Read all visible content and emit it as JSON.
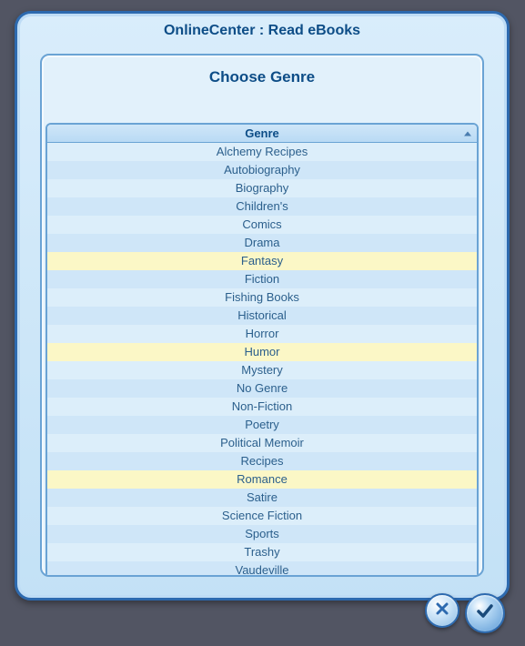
{
  "dialog": {
    "title": "OnlineCenter : Read eBooks",
    "subtitle": "Choose Genre",
    "column_header": "Genre"
  },
  "genres": [
    {
      "label": "Alchemy Recipes",
      "highlight": false
    },
    {
      "label": "Autobiography",
      "highlight": false
    },
    {
      "label": "Biography",
      "highlight": false
    },
    {
      "label": "Children's",
      "highlight": false
    },
    {
      "label": "Comics",
      "highlight": false
    },
    {
      "label": "Drama",
      "highlight": false
    },
    {
      "label": "Fantasy",
      "highlight": true
    },
    {
      "label": "Fiction",
      "highlight": false
    },
    {
      "label": "Fishing Books",
      "highlight": false
    },
    {
      "label": "Historical",
      "highlight": false
    },
    {
      "label": "Horror",
      "highlight": false
    },
    {
      "label": "Humor",
      "highlight": true
    },
    {
      "label": "Mystery",
      "highlight": false
    },
    {
      "label": "No Genre",
      "highlight": false
    },
    {
      "label": "Non-Fiction",
      "highlight": false
    },
    {
      "label": "Poetry",
      "highlight": false
    },
    {
      "label": "Political Memoir",
      "highlight": false
    },
    {
      "label": "Recipes",
      "highlight": false
    },
    {
      "label": "Romance",
      "highlight": true
    },
    {
      "label": "Satire",
      "highlight": false
    },
    {
      "label": "Science Fiction",
      "highlight": false
    },
    {
      "label": "Sports",
      "highlight": false
    },
    {
      "label": "Trashy",
      "highlight": false
    },
    {
      "label": "Vaudeville",
      "highlight": false
    }
  ],
  "buttons": {
    "close": "close",
    "accept": "accept"
  }
}
